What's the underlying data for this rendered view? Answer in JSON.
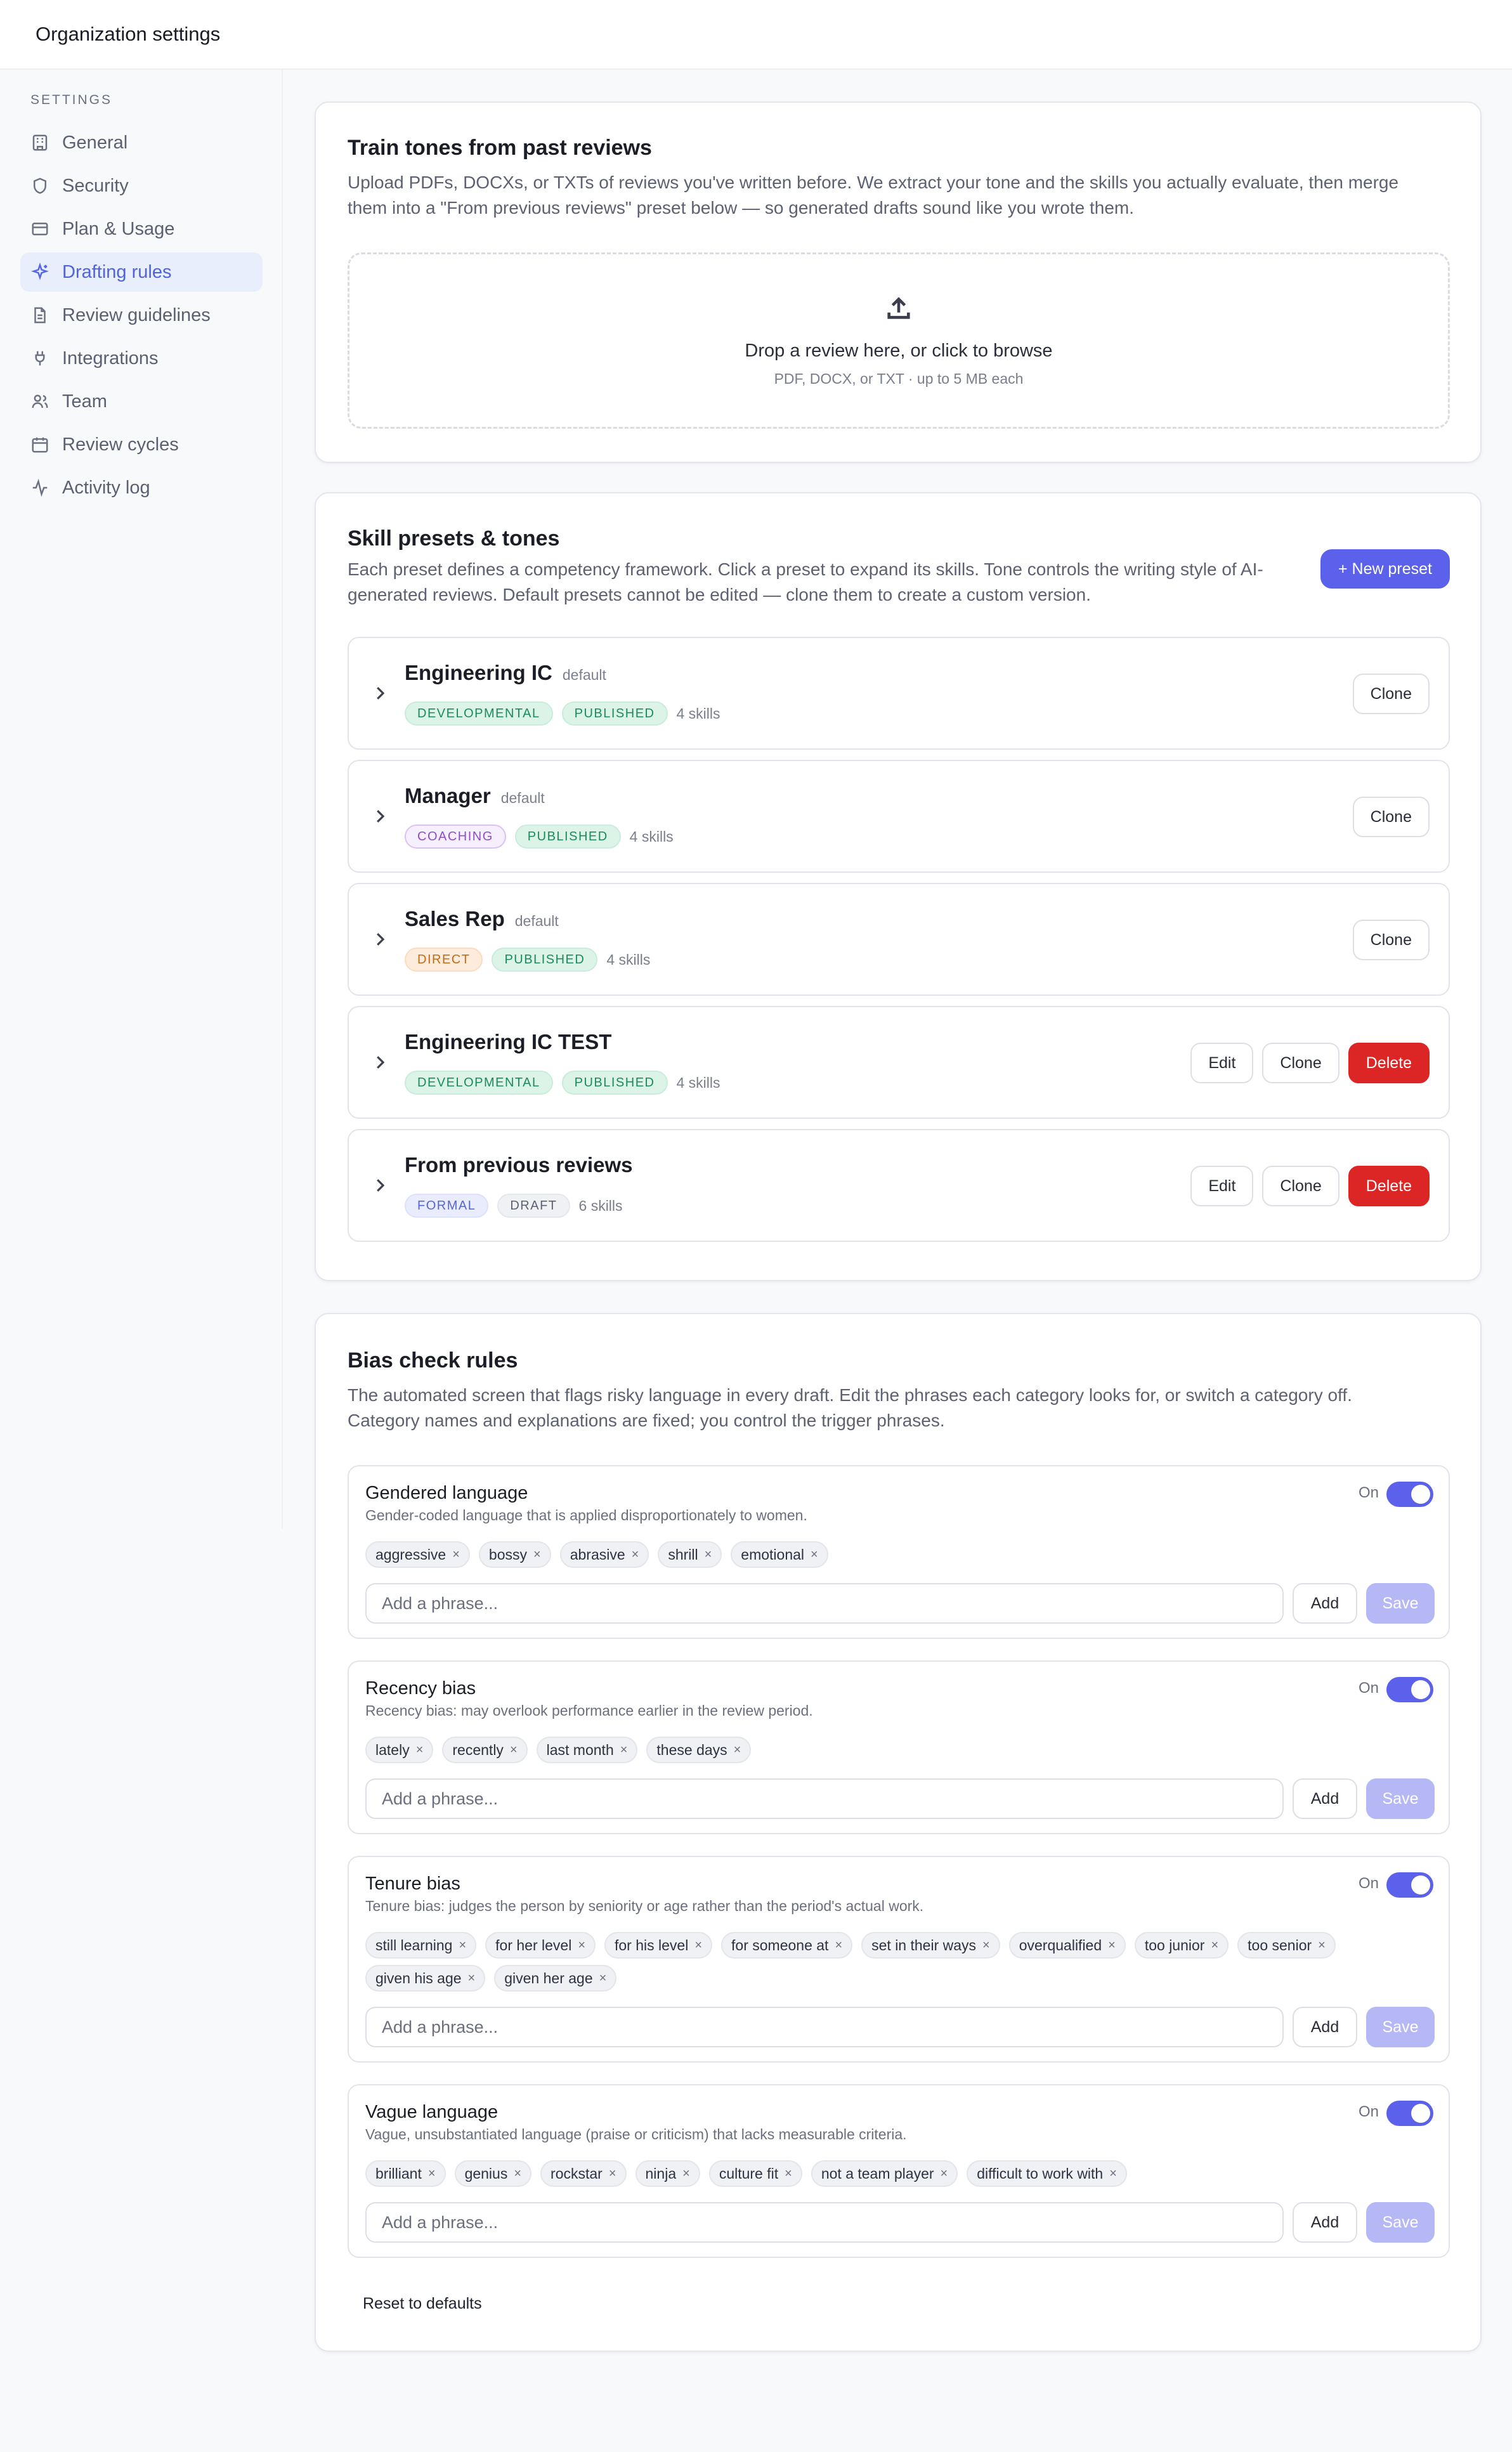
{
  "header": {
    "title": "Organization settings"
  },
  "sidebar": {
    "section_label": "SETTINGS",
    "items": [
      {
        "label": "General",
        "icon": "building-icon"
      },
      {
        "label": "Security",
        "icon": "shield-icon"
      },
      {
        "label": "Plan & Usage",
        "icon": "credit-card-icon"
      },
      {
        "label": "Drafting rules",
        "icon": "sparkle-icon",
        "active": true
      },
      {
        "label": "Review guidelines",
        "icon": "document-icon"
      },
      {
        "label": "Integrations",
        "icon": "plug-icon"
      },
      {
        "label": "Team",
        "icon": "users-icon"
      },
      {
        "label": "Review cycles",
        "icon": "calendar-icon"
      },
      {
        "label": "Activity log",
        "icon": "activity-icon"
      }
    ]
  },
  "train": {
    "title": "Train tones from past reviews",
    "desc_line1": "Upload PDFs, DOCXs, or TXTs of reviews you've written before. We extract your tone and the skills you actually evaluate, then merge",
    "desc_line2": "them into a \"From previous reviews\" preset below — so generated drafts sound like you wrote them.",
    "drop_main": "Drop a review here, or click to browse",
    "drop_sub": "PDF, DOCX, or TXT · up to 5 MB each"
  },
  "presets": {
    "title": "Skill presets & tones",
    "desc_line1": "Each preset defines a competency framework. Click a preset to expand its skills. Tone controls the writing style of AI-",
    "desc_line2": "generated reviews. Default presets cannot be edited — clone them to create a custom version.",
    "new_button": "+ New preset",
    "edit_label": "Edit",
    "clone_label": "Clone",
    "delete_label": "Delete",
    "items": [
      {
        "name": "Engineering IC",
        "default": "default",
        "tone": "DEVELOPMENTAL",
        "status": "PUBLISHED",
        "skills": "4 skills"
      },
      {
        "name": "Manager",
        "default": "default",
        "tone": "COACHING",
        "status": "PUBLISHED",
        "skills": "4 skills"
      },
      {
        "name": "Sales Rep",
        "default": "default",
        "tone": "DIRECT",
        "status": "PUBLISHED",
        "skills": "4 skills"
      },
      {
        "name": "Engineering IC TEST",
        "tone": "DEVELOPMENTAL",
        "status": "PUBLISHED",
        "skills": "4 skills"
      },
      {
        "name": "From previous reviews",
        "tone": "FORMAL",
        "status": "DRAFT",
        "skills": "6 skills"
      }
    ]
  },
  "bias": {
    "title": "Bias check rules",
    "desc_line1": "The automated screen that flags risky language in every draft. Edit the phrases each category looks for, or switch a category off.",
    "desc_line2": "Category names and explanations are fixed; you control the trigger phrases.",
    "on_label": "On",
    "placeholder": "Add a phrase...",
    "add_label": "Add",
    "save_label": "Save",
    "reset_label": "Reset to defaults",
    "rules": [
      {
        "name": "Gendered language",
        "desc": "Gender-coded language that is applied disproportionately to women.",
        "phrases": [
          "aggressive",
          "bossy",
          "abrasive",
          "shrill",
          "emotional"
        ]
      },
      {
        "name": "Recency bias",
        "desc": "Recency bias: may overlook performance earlier in the review period.",
        "phrases": [
          "lately",
          "recently",
          "last month",
          "these days"
        ]
      },
      {
        "name": "Tenure bias",
        "desc": "Tenure bias: judges the person by seniority or age rather than the period's actual work.",
        "phrases": [
          "still learning",
          "for her level",
          "for his level",
          "for someone at",
          "set in their ways",
          "overqualified",
          "too junior",
          "too senior",
          "given his age",
          "given her age"
        ]
      },
      {
        "name": "Vague language",
        "desc": "Vague, unsubstantiated language (praise or criticism) that lacks measurable criteria.",
        "phrases": [
          "brilliant",
          "genius",
          "rockstar",
          "ninja",
          "culture fit",
          "not a team player",
          "difficult to work with"
        ]
      }
    ]
  },
  "colors": {
    "accent": "#5b61ea",
    "danger": "#dc2626",
    "active_nav_bg": "#e8eefc"
  }
}
